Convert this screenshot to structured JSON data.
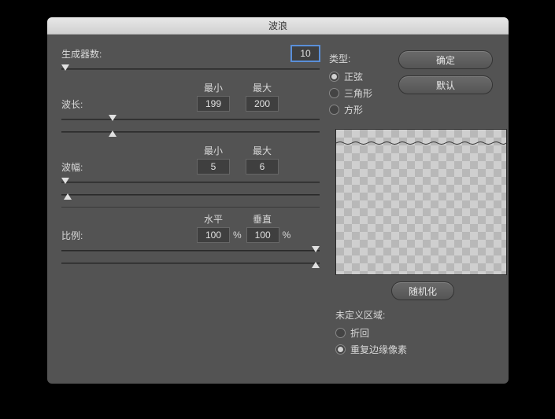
{
  "title": "波浪",
  "generators": {
    "label": "生成器数:",
    "value": "10"
  },
  "minmax": {
    "min": "最小",
    "max": "最大"
  },
  "wavelength": {
    "label": "波长:",
    "min": "199",
    "max": "200"
  },
  "amplitude": {
    "label": "波幅:",
    "min": "5",
    "max": "6"
  },
  "scale": {
    "label": "比例:",
    "h": "水平",
    "v": "垂直",
    "hval": "100",
    "vval": "100",
    "pct": "%"
  },
  "type": {
    "label": "类型:",
    "options": [
      "正弦",
      "三角形",
      "方形"
    ],
    "selected": 0
  },
  "undefined_area": {
    "label": "未定义区域:",
    "options": [
      "折回",
      "重复边缘像素"
    ],
    "selected": 1
  },
  "buttons": {
    "ok": "确定",
    "default": "默认",
    "randomize": "随机化"
  }
}
